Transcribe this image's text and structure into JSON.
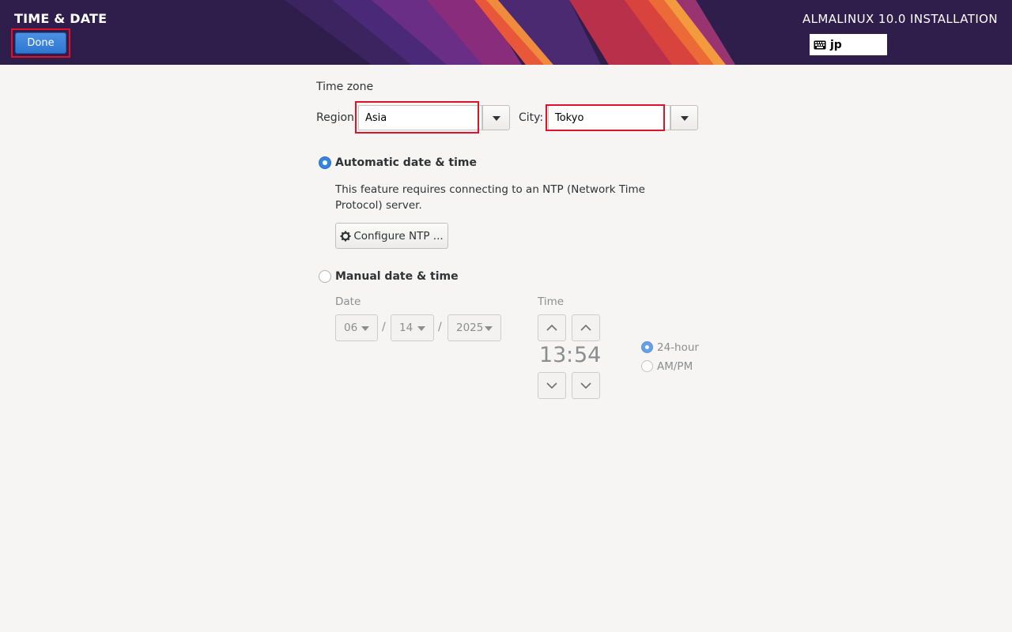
{
  "header": {
    "screen_title": "TIME & DATE",
    "done_label": "Done",
    "product_title": "ALMALINUX 10.0 INSTALLATION",
    "keyboard_layout": "jp"
  },
  "timezone": {
    "title": "Time zone",
    "region_label": "Region:",
    "region_value": "Asia",
    "city_label": "City:",
    "city_value": "Tokyo"
  },
  "automatic": {
    "label": "Automatic date & time",
    "selected": true,
    "description": "This feature requires connecting to an NTP (Network Time Protocol) server.",
    "configure_label": "Configure NTP ..."
  },
  "manual": {
    "label": "Manual date & time",
    "selected": false,
    "date_label": "Date",
    "month": "06",
    "day": "14",
    "year": "2025",
    "separator": "/",
    "time_label": "Time",
    "hours": "13",
    "time_separator": ":",
    "minutes": "54",
    "format_24h_label": "24-hour",
    "format_ampm_label": "AM/PM",
    "format_selected": "24-hour"
  },
  "colors": {
    "accent": "#3584e4",
    "highlight": "#e0112b",
    "header_bg": "#2f1e4c"
  }
}
